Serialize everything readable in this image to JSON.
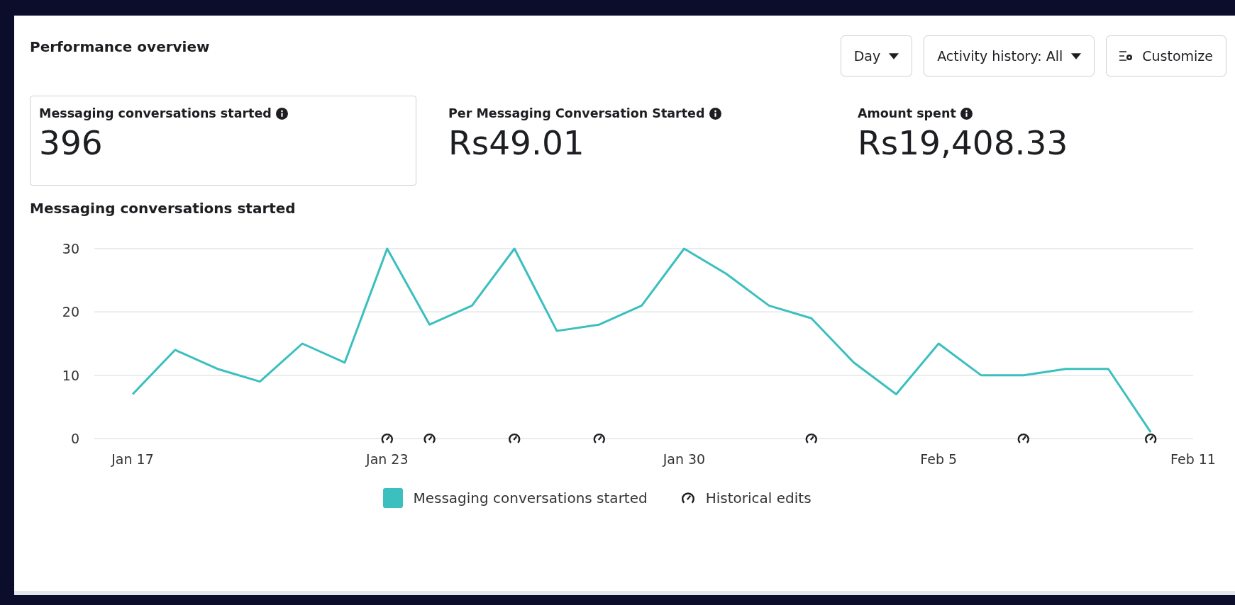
{
  "header": {
    "title": "Performance overview",
    "controls": [
      {
        "kind": "dropdown",
        "label": "Day"
      },
      {
        "kind": "dropdown",
        "label": "Activity history: All"
      },
      {
        "kind": "customize",
        "label": "Customize"
      }
    ]
  },
  "metrics": [
    {
      "label": "Messaging conversations started",
      "value": "396",
      "selected": true
    },
    {
      "label": "Per Messaging Conversation Started",
      "value": "Rs49.01",
      "selected": false
    },
    {
      "label": "Amount spent",
      "value": "Rs19,408.33",
      "selected": false
    }
  ],
  "chart": {
    "chart_data": {
      "type": "line",
      "title": "Messaging conversations started",
      "categories": [
        "Jan 17",
        null,
        null,
        null,
        null,
        null,
        "Jan 23",
        null,
        null,
        null,
        null,
        null,
        null,
        "Jan 30",
        null,
        null,
        null,
        null,
        null,
        "Feb 5",
        null,
        null,
        null,
        null,
        null,
        "Feb 11"
      ],
      "series": [
        {
          "name": "Messaging conversations started",
          "color": "#3bbfbf",
          "values": [
            7,
            14,
            11,
            9,
            15,
            12,
            30,
            18,
            21,
            30,
            17,
            18,
            21,
            30,
            26,
            21,
            19,
            12,
            7,
            15,
            10,
            10,
            11,
            11,
            1,
            null
          ]
        }
      ],
      "ylim": [
        0,
        30
      ],
      "yticks": [
        0,
        10,
        20,
        30
      ]
    },
    "edit_marks": [
      false,
      false,
      false,
      false,
      false,
      false,
      true,
      true,
      false,
      true,
      false,
      true,
      false,
      false,
      false,
      false,
      true,
      false,
      false,
      false,
      false,
      true,
      false,
      false,
      true,
      false
    ],
    "annotations_legend": "Historical edits"
  }
}
